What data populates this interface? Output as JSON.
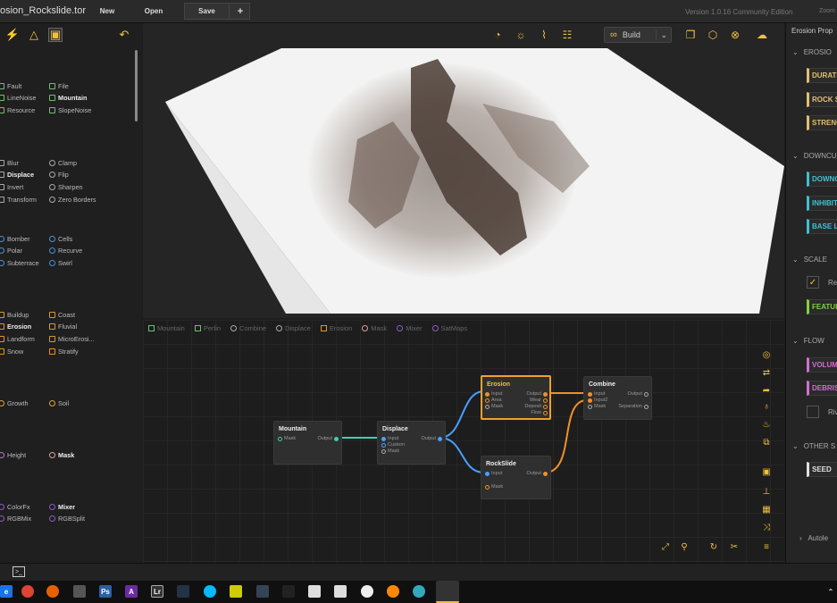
{
  "app": {
    "title": "osion_Rockslide.tor",
    "version": "Version 1.0.16 Community Edition",
    "zoom_label": "Zoom"
  },
  "toolbar": {
    "new_label": "New",
    "open_label": "Open",
    "save_label": "Save",
    "add_label": "+",
    "build_label": "Build"
  },
  "library": {
    "groups": [
      {
        "items": [
          {
            "label": "Fault",
            "shape": "box",
            "color": "#6fbf6f",
            "bold": false
          },
          {
            "label": "File",
            "shape": "box",
            "color": "#6fbf6f",
            "bold": false
          },
          {
            "label": "LineNoise",
            "shape": "box",
            "color": "#6fbf6f",
            "bold": false
          },
          {
            "label": "Mountain",
            "shape": "box",
            "color": "#6fbf6f",
            "bold": true
          },
          {
            "label": "Resource",
            "shape": "box",
            "color": "#6fbf6f",
            "bold": false
          },
          {
            "label": "SlopeNoise",
            "shape": "box",
            "color": "#6fbf6f",
            "bold": false
          }
        ]
      },
      {
        "items": [
          {
            "label": "Blur",
            "shape": "box",
            "color": "#aaaaaa",
            "bold": false
          },
          {
            "label": "Clamp",
            "shape": "circ",
            "color": "#aaaaaa",
            "bold": false
          },
          {
            "label": "Displace",
            "shape": "box",
            "color": "#aaaaaa",
            "bold": true
          },
          {
            "label": "Flip",
            "shape": "circ",
            "color": "#aaaaaa",
            "bold": false
          },
          {
            "label": "Invert",
            "shape": "box",
            "color": "#aaaaaa",
            "bold": false
          },
          {
            "label": "Sharpen",
            "shape": "circ",
            "color": "#aaaaaa",
            "bold": false
          },
          {
            "label": "Transform",
            "shape": "box",
            "color": "#aaaaaa",
            "bold": false
          },
          {
            "label": "Zero Borders",
            "shape": "circ",
            "color": "#aaaaaa",
            "bold": false
          }
        ]
      },
      {
        "items": [
          {
            "label": "Bomber",
            "shape": "circ",
            "color": "#4a90d9",
            "bold": false
          },
          {
            "label": "Cells",
            "shape": "circ",
            "color": "#4a90d9",
            "bold": false
          },
          {
            "label": "Polar",
            "shape": "circ",
            "color": "#4a90d9",
            "bold": false
          },
          {
            "label": "Recurve",
            "shape": "circ",
            "color": "#4a90d9",
            "bold": false
          },
          {
            "label": "Subterrace",
            "shape": "circ",
            "color": "#4a90d9",
            "bold": false
          },
          {
            "label": "Swirl",
            "shape": "circ",
            "color": "#4a90d9",
            "bold": false
          }
        ]
      },
      {
        "items": [
          {
            "label": "Buildup",
            "shape": "box",
            "color": "#e0962e",
            "bold": false
          },
          {
            "label": "Coast",
            "shape": "box",
            "color": "#e0962e",
            "bold": false
          },
          {
            "label": "Erosion",
            "shape": "box",
            "color": "#e0962e",
            "bold": true
          },
          {
            "label": "Fluvial",
            "shape": "box",
            "color": "#e0962e",
            "bold": false
          },
          {
            "label": "Landform",
            "shape": "box",
            "color": "#e0962e",
            "bold": false
          },
          {
            "label": "MicroErosi...",
            "shape": "box",
            "color": "#e0962e",
            "bold": false
          },
          {
            "label": "Snow",
            "shape": "box",
            "color": "#e0962e",
            "bold": false
          },
          {
            "label": "Stratify",
            "shape": "box",
            "color": "#e0962e",
            "bold": false
          }
        ]
      },
      {
        "items": [
          {
            "label": "Growth",
            "shape": "circ",
            "color": "#d9a640",
            "bold": false
          },
          {
            "label": "Soil",
            "shape": "circ",
            "color": "#d9a640",
            "bold": false
          }
        ]
      },
      {
        "items": [
          {
            "label": "Height",
            "shape": "circ",
            "color": "#b07cc6",
            "bold": false
          },
          {
            "label": "Mask",
            "shape": "circ",
            "color": "#d9a0a0",
            "bold": true
          }
        ]
      },
      {
        "items": [
          {
            "label": "ColorFx",
            "shape": "circ",
            "color": "#8a5cc6",
            "bold": false
          },
          {
            "label": "Mixer",
            "shape": "circ",
            "color": "#8a5cc6",
            "bold": true
          },
          {
            "label": "RGBMix",
            "shape": "circ",
            "color": "#8a5cc6",
            "bold": false
          },
          {
            "label": "RGBSplit",
            "shape": "circ",
            "color": "#8a5cc6",
            "bold": false
          }
        ]
      }
    ]
  },
  "breadcrumbs": [
    {
      "label": "Mountain",
      "shape": "box",
      "color": "#6fbf6f"
    },
    {
      "label": "Perlin",
      "shape": "box",
      "color": "#6fbf6f"
    },
    {
      "label": "Combine",
      "shape": "circ",
      "color": "#aaaaaa"
    },
    {
      "label": "Displace",
      "shape": "circ",
      "color": "#aaaaaa"
    },
    {
      "label": "Erosion",
      "shape": "box",
      "color": "#e0962e"
    },
    {
      "label": "Mask",
      "shape": "circ",
      "color": "#d9a0a0"
    },
    {
      "label": "Mixer",
      "shape": "circ",
      "color": "#8a5cc6"
    },
    {
      "label": "SatMaps",
      "shape": "circ",
      "color": "#8a5cc6"
    }
  ],
  "nodes": {
    "mountain": {
      "title": "Mountain",
      "in": [
        "Mask"
      ],
      "out": [
        "Output"
      ]
    },
    "displace": {
      "title": "Displace",
      "in": [
        "Input",
        "Custom",
        "Mask"
      ],
      "out": [
        "Output"
      ]
    },
    "erosion": {
      "title": "Erosion",
      "in": [
        "Input",
        "Area",
        "Mask"
      ],
      "out": [
        "Output",
        "Wear",
        "Deposit",
        "Flow"
      ]
    },
    "rockslide": {
      "title": "RockSlide",
      "in": [
        "Input",
        "Mask"
      ],
      "out": [
        "Output"
      ]
    },
    "combine": {
      "title": "Combine",
      "in": [
        "Input",
        "Input2",
        "Mask"
      ],
      "out": [
        "Output",
        "Separation"
      ]
    }
  },
  "props": {
    "title": "Erosion Prop",
    "sections": [
      {
        "label": "EROSIO",
        "fields": [
          {
            "label": "DURATI",
            "color": "#e0c070"
          },
          {
            "label": "ROCK S",
            "color": "#e0c070"
          },
          {
            "label": "STRENG",
            "color": "#e0c070"
          }
        ]
      },
      {
        "label": "DOWNCU",
        "fields": [
          {
            "label": "DOWNC",
            "color": "#40c0d0"
          },
          {
            "label": "INHIBIT",
            "color": "#40c0d0"
          },
          {
            "label": "BASE LI",
            "color": "#40c0d0"
          }
        ]
      },
      {
        "label": "SCALE",
        "fields": [
          {
            "label": "FEATUR",
            "color": "#80d040"
          }
        ],
        "checkbox": "Re"
      },
      {
        "label": "FLOW",
        "fields": [
          {
            "label": "VOLUM",
            "color": "#d070d0"
          },
          {
            "label": "DEBRIS",
            "color": "#d070d0"
          }
        ],
        "checkbox2": "Riv"
      },
      {
        "label": "OTHER S",
        "fields": [
          {
            "label": "SEED",
            "color": "#e0e0e0"
          }
        ]
      }
    ],
    "autolevel": "Autole"
  }
}
